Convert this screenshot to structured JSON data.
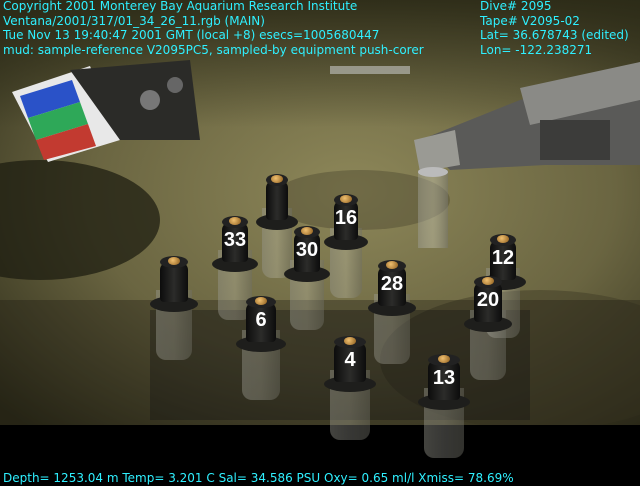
{
  "overlay": {
    "top_left": [
      "Copyright 2001 Monterey Bay Aquarium Research Institute",
      "Ventana/2001/317/01_34_26_11.rgb (MAIN)",
      "Tue Nov 13 19:40:47 2001 GMT (local +8)  esecs=1005680447",
      "mud: sample-reference V2095PC5, sampled-by equipment push-corer"
    ],
    "top_right": [
      "Dive# 2095",
      "Tape# V2095-02",
      "Lat= 36.678743 (edited)",
      "Lon= -122.238271"
    ],
    "bottom": "Depth= 1253.04 m  Temp= 3.201 C  Sal= 34.586 PSU  Oxy= 0.65 ml/l  Xmiss= 78.69%"
  },
  "core_labels": [
    "33",
    "30",
    "16",
    "28",
    "6",
    "4",
    "13",
    "12",
    "20"
  ],
  "colors": {
    "overlay_text": "#2ff0ff",
    "seafloor": "#6f6a46",
    "sky_dark": "#1b1a10",
    "label_text": "#ffffff",
    "cap_copper": "#c0842e"
  }
}
